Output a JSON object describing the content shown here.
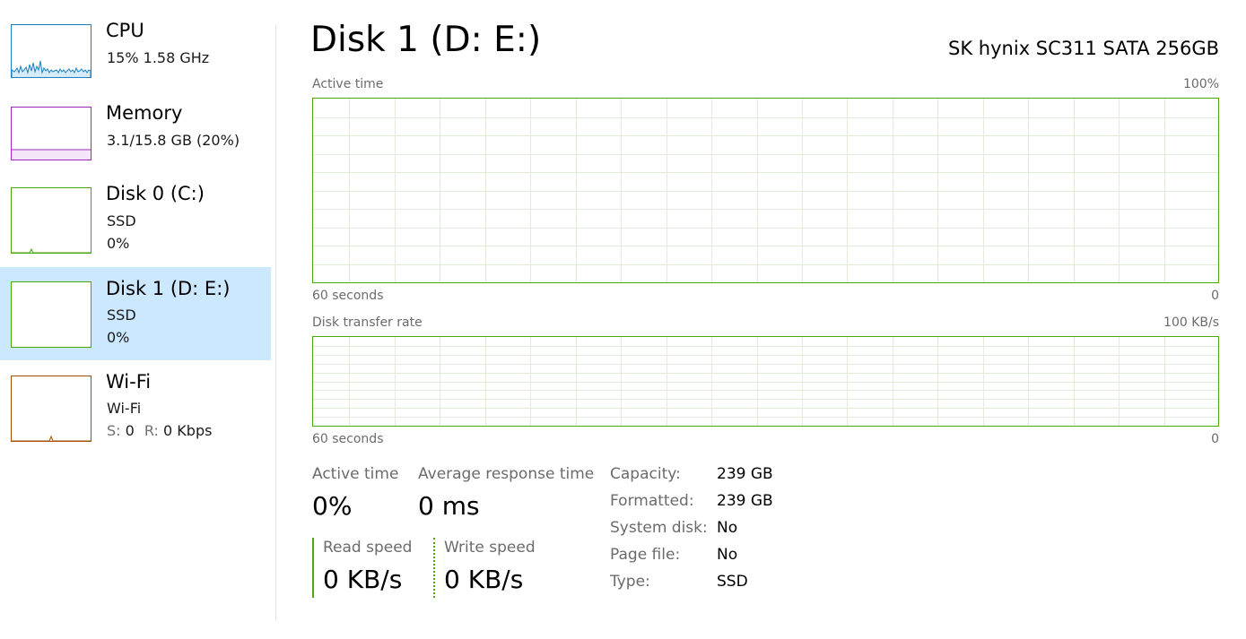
{
  "sidebar": {
    "items": [
      {
        "title": "CPU",
        "line1": "15%  1.58 GHz",
        "line2": "",
        "color": "#1d7fbf",
        "selected": false
      },
      {
        "title": "Memory",
        "line1": "3.1/15.8 GB (20%)",
        "line2": "",
        "color": "#9b2bbf",
        "selected": false
      },
      {
        "title": "Disk 0 (C:)",
        "line1": "SSD",
        "line2": "0%",
        "color": "#4da60c",
        "selected": false
      },
      {
        "title": "Disk 1 (D: E:)",
        "line1": "SSD",
        "line2": "0%",
        "color": "#4da60c",
        "selected": true
      },
      {
        "title": "Wi-Fi",
        "line1": "Wi-Fi",
        "line2_s_label": "S:",
        "line2_s_value": "0",
        "line2_r_label": "R:",
        "line2_r_value": "0 Kbps",
        "color": "#a74f01",
        "selected": false
      }
    ]
  },
  "main": {
    "title": "Disk 1 (D: E:)",
    "model": "SK hynix SC311 SATA 256GB",
    "active_graph": {
      "label": "Active time",
      "max": "100%",
      "time_span": "60 seconds",
      "min": "0"
    },
    "transfer_graph": {
      "label": "Disk transfer rate",
      "max": "100 KB/s",
      "time_span": "60 seconds",
      "min": "0"
    },
    "stats": {
      "active_time_label": "Active time",
      "active_time_value": "0%",
      "avg_response_label": "Average response time",
      "avg_response_value": "0 ms",
      "read_speed_label": "Read speed",
      "read_speed_value": "0 KB/s",
      "write_speed_label": "Write speed",
      "write_speed_value": "0 KB/s"
    },
    "properties": [
      {
        "label": "Capacity:",
        "value": "239 GB"
      },
      {
        "label": "Formatted:",
        "value": "239 GB"
      },
      {
        "label": "System disk:",
        "value": "No"
      },
      {
        "label": "Page file:",
        "value": "No"
      },
      {
        "label": "Type:",
        "value": "SSD"
      }
    ]
  },
  "colors": {
    "disk_accent": "#4da60c",
    "grid": "#e3ecd8",
    "selected_bg": "#cce8ff"
  }
}
